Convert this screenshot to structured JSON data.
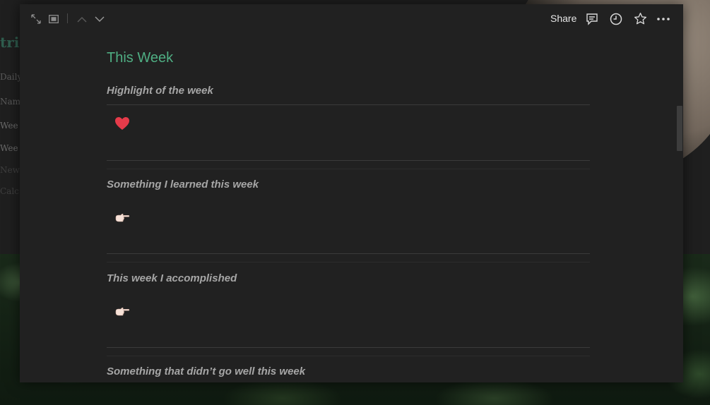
{
  "background": {
    "sidebar_title": "trie",
    "sidebar_items": [
      "Daily",
      "Nam",
      "Wee",
      "Wee",
      "New",
      "Calc"
    ],
    "top_text": "                                                        "
  },
  "toolbar": {
    "expand_icon": "expand-arrows-icon",
    "fullscreen_icon": "fullscreen-icon",
    "prev_icon": "chevron-up-icon",
    "next_icon": "chevron-down-icon",
    "share_label": "Share",
    "comment_icon": "comment-icon",
    "history_icon": "clock-icon",
    "favorite_icon": "star-icon",
    "more_icon": "more-icon"
  },
  "page": {
    "title": "This Week",
    "sections": [
      {
        "heading": "Highlight of the week",
        "emoji": "red-heart"
      },
      {
        "heading": "Something I learned this week",
        "emoji": "backhand-index-pointing-right"
      },
      {
        "heading": "This week I accomplished",
        "emoji": "backhand-index-pointing-right"
      },
      {
        "heading": "Something that didn’t go well this week",
        "emoji": ""
      }
    ]
  },
  "colors": {
    "modal_bg": "#212121",
    "title_accent": "#4fae83",
    "heading_text": "#a6a6a6",
    "heart": "#e63b4a",
    "hand": "#f5e0d6"
  }
}
